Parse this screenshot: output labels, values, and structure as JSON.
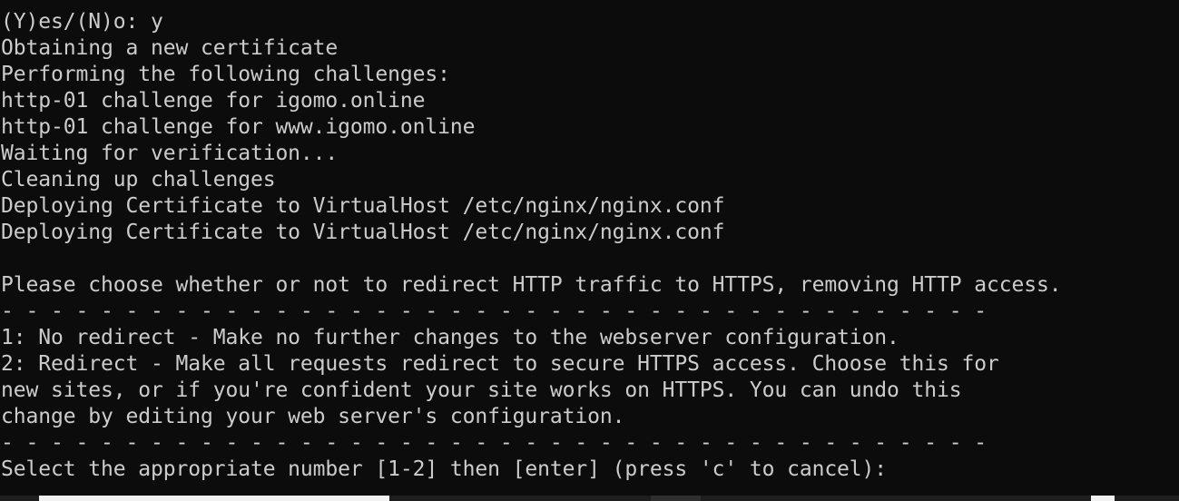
{
  "terminal": {
    "lines": [
      "(Y)es/(N)o: y",
      "Obtaining a new certificate",
      "Performing the following challenges:",
      "http-01 challenge for igomo.online",
      "http-01 challenge for www.igomo.online",
      "Waiting for verification...",
      "Cleaning up challenges",
      "Deploying Certificate to VirtualHost /etc/nginx/nginx.conf",
      "Deploying Certificate to VirtualHost /etc/nginx/nginx.conf",
      "",
      "Please choose whether or not to redirect HTTP traffic to HTTPS, removing HTTP access.",
      "- - - - - - - - - - - - - - - - - - - - - - - - - - - - - - - - - - - - - - - -",
      "1: No redirect - Make no further changes to the webserver configuration.",
      "2: Redirect - Make all requests redirect to secure HTTPS access. Choose this for",
      "new sites, or if you're confident your site works on HTTPS. You can undo this",
      "change by editing your web server's configuration.",
      "- - - - - - - - - - - - - - - - - - - - - - - - - - - - - - - - - - - - - - - -",
      "Select the appropriate number [1-2] then [enter] (press 'c' to cancel):"
    ]
  },
  "colors": {
    "background": "#0c0c0c",
    "foreground": "#cccccc"
  }
}
